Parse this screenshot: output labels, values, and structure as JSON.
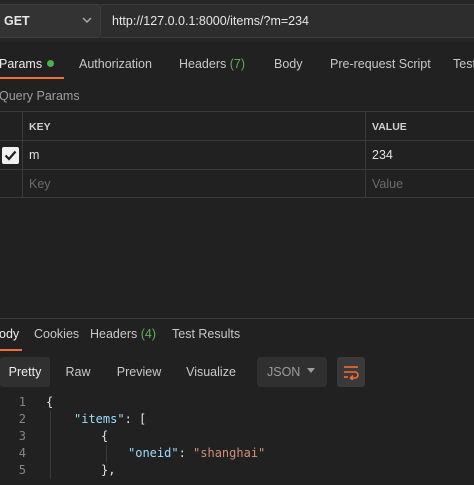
{
  "request": {
    "method": "GET",
    "url": "http://127.0.0.1:8000/items/?m=234"
  },
  "request_tabs": [
    {
      "label": "Params",
      "active": true,
      "dot": true
    },
    {
      "label": "Authorization"
    },
    {
      "label": "Headers",
      "count": "(7)"
    },
    {
      "label": "Body"
    },
    {
      "label": "Pre-request Script"
    },
    {
      "label": "Test"
    }
  ],
  "query_params": {
    "title": "Query Params",
    "columns": {
      "key": "KEY",
      "value": "VALUE"
    },
    "rows": [
      {
        "checked": true,
        "key": "m",
        "value": "234"
      }
    ],
    "placeholder": {
      "key": "Key",
      "value": "Value"
    }
  },
  "response_tabs": [
    {
      "label": "ody",
      "active": true
    },
    {
      "label": "Cookies"
    },
    {
      "label": "Headers",
      "count": "(4)"
    },
    {
      "label": "Test Results"
    }
  ],
  "view_modes": {
    "pretty": "Pretty",
    "raw": "Raw",
    "preview": "Preview",
    "visualize": "Visualize",
    "format": "JSON"
  },
  "code_lines": [
    {
      "n": "1"
    },
    {
      "n": "2"
    },
    {
      "n": "3"
    },
    {
      "n": "4"
    },
    {
      "n": "5"
    }
  ],
  "code": {
    "l1": "{",
    "l2_key": "\"items\"",
    "l2_rest": ": [",
    "l3": "{",
    "l4_key": "\"oneid\"",
    "l4_colon": ": ",
    "l4_val": "\"shanghai\"",
    "l5": "},"
  },
  "colors": {
    "accent": "#f26b3a",
    "dot": "#4caf50",
    "count": "#5fae5a"
  }
}
